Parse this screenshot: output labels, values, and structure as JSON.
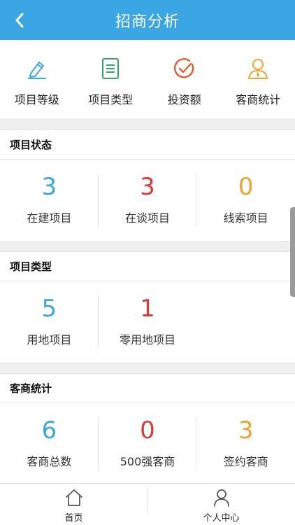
{
  "header": {
    "title": "招商分析"
  },
  "quick_menu": [
    {
      "label": "项目等级",
      "icon": "pen-icon",
      "color": "#3aa6e3"
    },
    {
      "label": "项目类型",
      "icon": "document-list-icon",
      "color": "#2ea862"
    },
    {
      "label": "投资额",
      "icon": "check-circle-icon",
      "color": "#e8592e"
    },
    {
      "label": "客商统计",
      "icon": "person-icon",
      "color": "#f0a230"
    }
  ],
  "sections": {
    "project_status": {
      "title": "项目状态",
      "items": [
        {
          "value": "3",
          "label": "在建项目",
          "color": "#3aa6e3"
        },
        {
          "value": "3",
          "label": "在谈项目",
          "color": "#d93a37"
        },
        {
          "value": "0",
          "label": "线索项目",
          "color": "#f0a230"
        }
      ]
    },
    "project_type": {
      "title": "项目类型",
      "items": [
        {
          "value": "5",
          "label": "用地项目",
          "color": "#3aa6e3"
        },
        {
          "value": "1",
          "label": "零用地项目",
          "color": "#d93a37"
        }
      ]
    },
    "merchant_stats": {
      "title": "客商统计",
      "items": [
        {
          "value": "6",
          "label": "客商总数",
          "color": "#3aa6e3"
        },
        {
          "value": "0",
          "label": "500强客商",
          "color": "#d93a37"
        },
        {
          "value": "3",
          "label": "签约客商",
          "color": "#f0a230"
        }
      ]
    }
  },
  "tabbar": [
    {
      "label": "首页",
      "icon": "home-icon"
    },
    {
      "label": "个人中心",
      "icon": "user-icon"
    }
  ]
}
